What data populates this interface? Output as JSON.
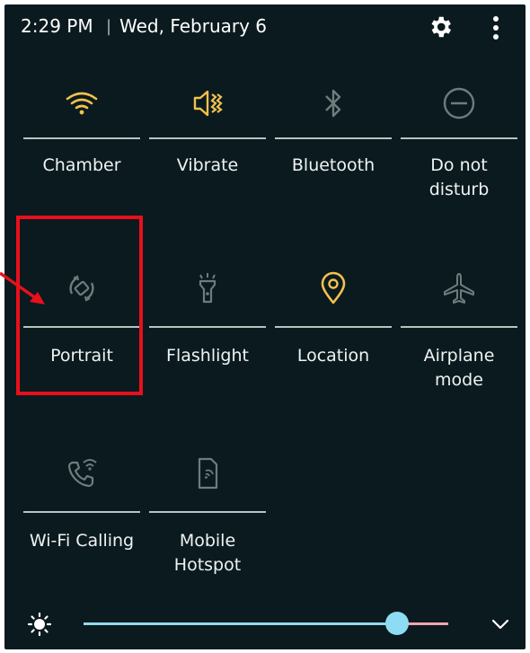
{
  "status": {
    "time": "2:29 PM",
    "separator": "|",
    "date": "Wed, February 6",
    "icons": [
      "gear-icon",
      "more-vert-icon"
    ]
  },
  "tiles": [
    {
      "label": "Chamber",
      "icon": "wifi-icon",
      "active": true
    },
    {
      "label": "Vibrate",
      "icon": "vibrate-icon",
      "active": true
    },
    {
      "label": "Bluetooth",
      "icon": "bluetooth-icon",
      "active": false
    },
    {
      "label": "Do not\ndisturb",
      "icon": "do-not-disturb-icon",
      "active": false
    },
    {
      "label": "Portrait",
      "icon": "auto-rotate-icon",
      "active": false
    },
    {
      "label": "Flashlight",
      "icon": "flashlight-icon",
      "active": false
    },
    {
      "label": "Location",
      "icon": "location-icon",
      "active": true
    },
    {
      "label": "Airplane\nmode",
      "icon": "airplane-icon",
      "active": false
    },
    {
      "label": "Wi-Fi Calling",
      "icon": "wifi-calling-icon",
      "active": false
    },
    {
      "label": "Mobile\nHotspot",
      "icon": "mobile-hotspot-icon",
      "active": false
    }
  ],
  "brightness": {
    "level": 0.86,
    "icons": [
      "brightness-icon",
      "chevron-down-icon"
    ]
  },
  "colors": {
    "background": "#0b1a1f",
    "active_icon": "#f2c14e",
    "inactive_icon": "#6d7d7c",
    "slider": "#8ddcf4",
    "highlight": "#e8101b"
  }
}
